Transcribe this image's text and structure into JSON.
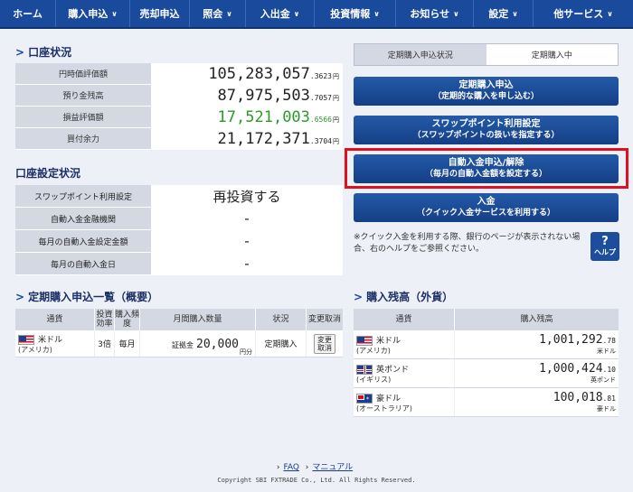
{
  "nav": [
    {
      "label": "ホーム",
      "chev": false
    },
    {
      "label": "購入申込",
      "chev": true
    },
    {
      "label": "売却申込",
      "chev": false
    },
    {
      "label": "照会",
      "chev": true
    },
    {
      "label": "入出金",
      "chev": true
    },
    {
      "label": "投資情報",
      "chev": true
    },
    {
      "label": "お知らせ",
      "chev": true
    },
    {
      "label": "設定",
      "chev": true
    },
    {
      "label": "他サービス",
      "chev": true
    }
  ],
  "account": {
    "title": "口座状況",
    "rows": [
      {
        "label": "円時価評価額",
        "main": "105,283,057",
        "dec": ".3623",
        "unit": "円"
      },
      {
        "label": "預り金残高",
        "main": "87,975,503",
        "dec": ".7057",
        "unit": "円"
      },
      {
        "label": "損益評価額",
        "main": "17,521,003",
        "dec": ".6566",
        "unit": "円"
      },
      {
        "label": "買付余力",
        "main": "21,172,371",
        "dec": ".3704",
        "unit": "円"
      }
    ]
  },
  "settings": {
    "title": "口座設定状況",
    "rows": [
      {
        "label": "スワップポイント利用設定",
        "value": "再投資する"
      },
      {
        "label": "自動入金金融機関",
        "value": "-"
      },
      {
        "label": "毎月の自動入金設定金額",
        "value": "-"
      },
      {
        "label": "毎月の自動入金日",
        "value": "-"
      }
    ]
  },
  "tabs": {
    "left": "定期購入申込状況",
    "right": "定期購入中"
  },
  "buttons": {
    "regular": {
      "l1": "定期購入申込",
      "l2": "（定期的な購入を申し込む）"
    },
    "swap": {
      "l1": "スワップポイント利用設定",
      "l2": "（スワップポイントの扱いを指定する）"
    },
    "auto": {
      "l1": "自動入金申込/解除",
      "l2": "（毎月の自動入金額を設定する）"
    },
    "deposit": {
      "l1": "入金",
      "l2": "（クイック入金サービスを利用する）"
    }
  },
  "note": "※クイック入金を利用する際、銀行のページが表示されない場合、右のヘルプをご参照ください。",
  "help": {
    "q": "?",
    "label": "ヘルプ"
  },
  "regularList": {
    "title": "定期購入申込一覧（概要）",
    "headers": [
      "通貨",
      "投資効率",
      "購入頻度",
      "月間購入数量",
      "状況",
      "変更取消"
    ],
    "row": {
      "currency": "米ドル",
      "country": "(アメリカ)",
      "leverage": "3倍",
      "freq": "毎月",
      "qtyPrefix": "証拠金",
      "qty": "20,000",
      "qtyUnit": "円分",
      "status": "定期購入",
      "btn1": "変更",
      "btn2": "取消"
    }
  },
  "holdings": {
    "title": "購入残高（外貨）",
    "headers": [
      "通貨",
      "購入残高"
    ],
    "rows": [
      {
        "name": "米ドル",
        "country": "(アメリカ)",
        "main": "1,001,292",
        "dec": ".78",
        "unit": "米ドル",
        "flag": "us"
      },
      {
        "name": "英ポンド",
        "country": "(イギリス)",
        "main": "1,000,424",
        "dec": ".10",
        "unit": "英ポンド",
        "flag": "uk"
      },
      {
        "name": "豪ドル",
        "country": "(オーストラリア)",
        "main": "100,018",
        "dec": ".81",
        "unit": "豪ドル",
        "flag": "au"
      }
    ]
  },
  "footer": {
    "faq": "FAQ",
    "manual": "マニュアル",
    "copyright": "Copyright SBI FXTRADE Co., Ltd. All Rights Reserved."
  },
  "colors": {
    "nav": "#1a4a9c",
    "accent": "#e01020",
    "gain": "#2a9a2a"
  }
}
